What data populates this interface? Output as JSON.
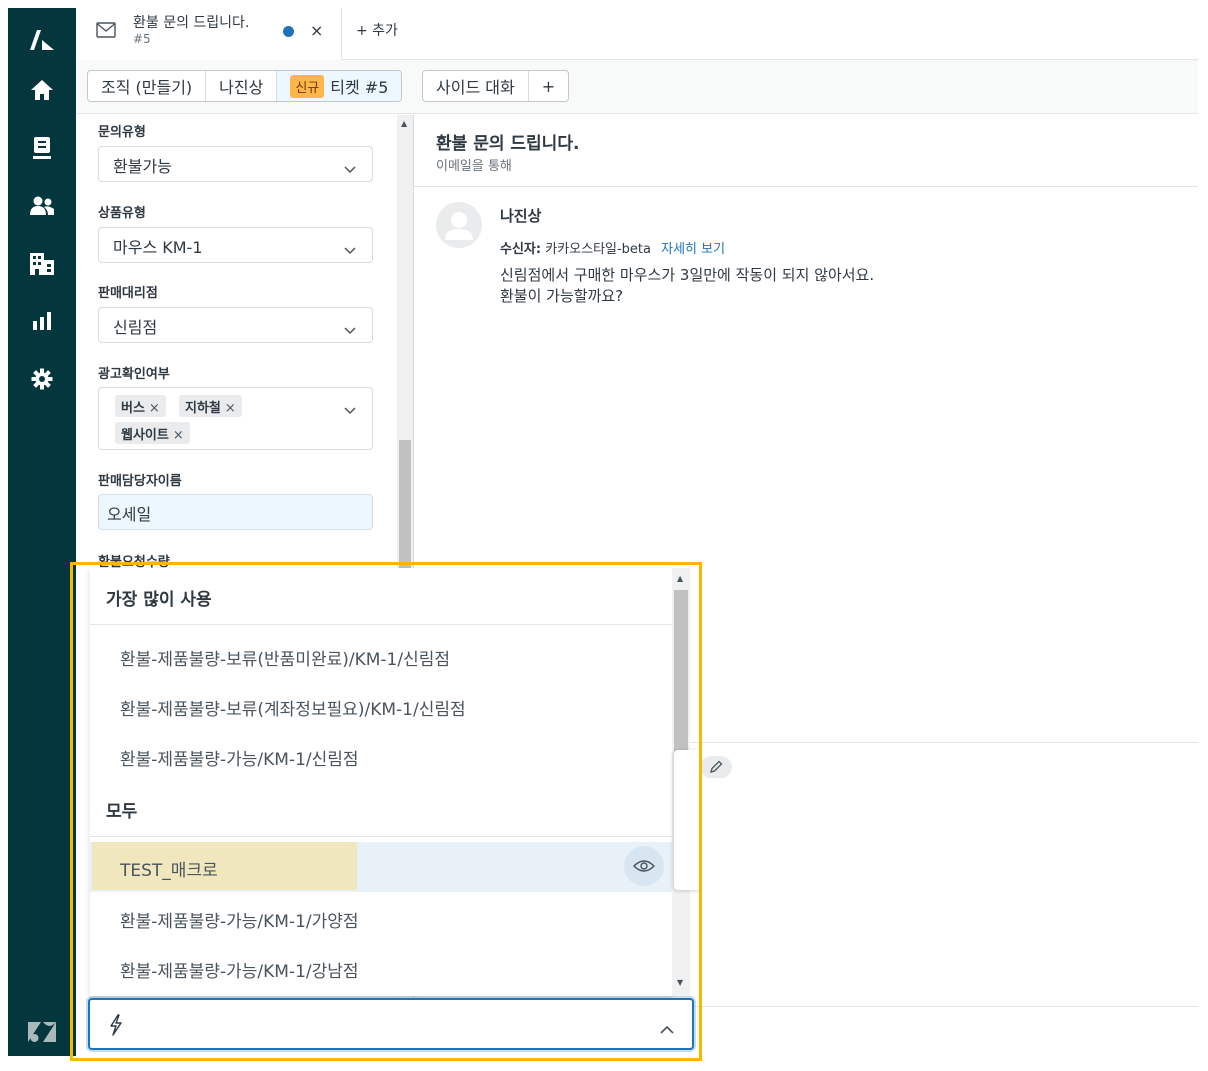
{
  "tabs": {
    "ticket_title": "환불 문의 드립니다.",
    "ticket_number": "#5",
    "close_symbol": "×",
    "add_label": "+ 추가"
  },
  "breadcrumb": {
    "org": "조직 (만들기)",
    "requester": "나진상",
    "status_badge": "신규",
    "ticket": "티켓 #5",
    "side_conversation": "사이드 대화",
    "plus": "+"
  },
  "fields": {
    "inquiry_type": {
      "label": "문의유형",
      "value": "환불가능"
    },
    "product_type": {
      "label": "상품유형",
      "value": "마우스 KM-1"
    },
    "reseller": {
      "label": "판매대리점",
      "value": "신림점"
    },
    "ad_check": {
      "label": "광고확인여부",
      "tags": [
        "버스",
        "지하철",
        "웹사이트"
      ]
    },
    "sales_rep": {
      "label": "판매담당자이름",
      "value": "오세일"
    },
    "refund_qty": {
      "label": "환불요청수량"
    }
  },
  "conversation": {
    "subject": "환불 문의 드립니다.",
    "via": "이메일을 통해",
    "author": "나진상",
    "to_label": "수신자:",
    "to_value": "카카오스타일-beta",
    "details_link": "자세히 보기",
    "body_line1": "신림점에서 구매한 마우스가 3일만에 작동이 되지 않아서요.",
    "body_line2": "환불이 가능할까요?"
  },
  "macro_dropdown": {
    "section_frequent": "가장 많이 사용",
    "frequent_items": [
      "환불-제품불량-보류(반품미완료)/KM-1/신림점",
      "환불-제품불량-보류(계좌정보필요)/KM-1/신림점",
      "환불-제품불량-가능/KM-1/신림점"
    ],
    "section_all": "모두",
    "highlighted_item": "TEST_매크로",
    "all_items": [
      "환불-제품불량-가능/KM-1/가양점",
      "환불-제품불량-가능/KM-1/강남점"
    ]
  },
  "colors": {
    "rail": "#03363d",
    "accent_blue": "#1f73b7",
    "highlight_frame": "#f6b900",
    "new_badge": "#ffb648"
  }
}
